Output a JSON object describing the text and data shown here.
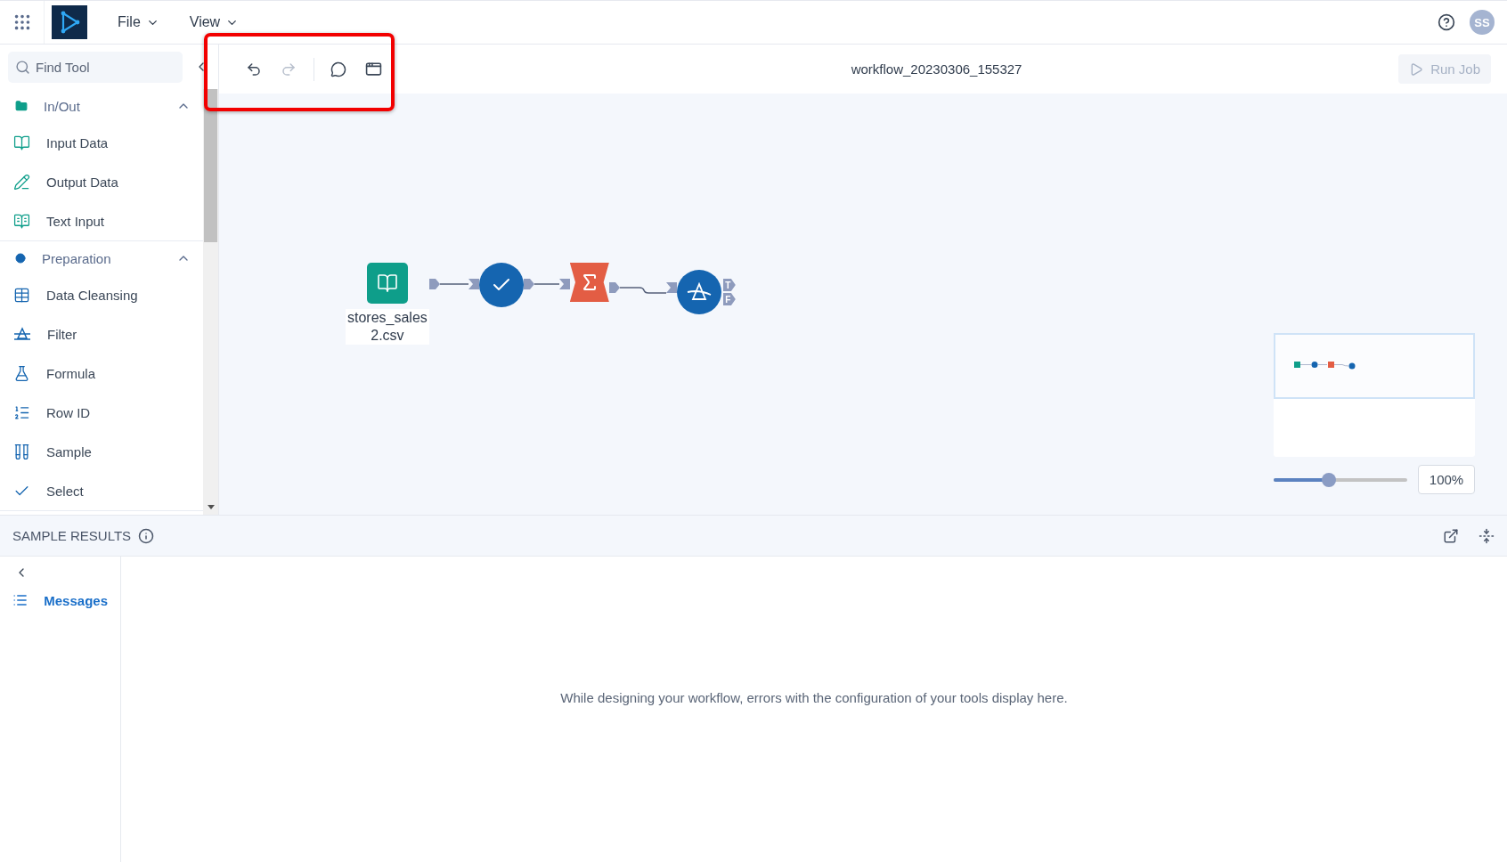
{
  "topbar": {
    "menus": [
      {
        "label": "File"
      },
      {
        "label": "View"
      }
    ],
    "avatar": "SS"
  },
  "sidebar": {
    "search": {
      "placeholder": "Find Tool"
    },
    "groups": [
      {
        "label": "In/Out",
        "kind": "folder",
        "color": "#0e9e8a",
        "expanded": true,
        "items": [
          {
            "label": "Input Data",
            "kind": "input"
          },
          {
            "label": "Output Data",
            "kind": "output"
          },
          {
            "label": "Text Input",
            "kind": "text-input"
          }
        ]
      },
      {
        "label": "Preparation",
        "kind": "dot",
        "color": "#1565b0",
        "expanded": true,
        "items": [
          {
            "label": "Data Cleansing",
            "kind": "cleansing"
          },
          {
            "label": "Filter",
            "kind": "filter"
          },
          {
            "label": "Formula",
            "kind": "formula"
          },
          {
            "label": "Row ID",
            "kind": "row-id"
          },
          {
            "label": "Sample",
            "kind": "sample"
          },
          {
            "label": "Select",
            "kind": "select"
          }
        ]
      }
    ]
  },
  "toolbar": {
    "undo": {
      "disabled": false
    },
    "redo": {
      "disabled": true
    },
    "title": "workflow_20230306_155327",
    "run_button": {
      "label": "Run Job",
      "disabled": true
    }
  },
  "canvas": {
    "nodes": [
      {
        "kind": "input",
        "color": "#0e9e8a",
        "label_lines": [
          "stores_sales",
          "2.csv"
        ]
      },
      {
        "kind": "select",
        "color": "#1565b0"
      },
      {
        "kind": "summarize",
        "color": "#e35d44"
      },
      {
        "kind": "filter",
        "color": "#1565b0",
        "outputs": [
          "T",
          "F"
        ]
      }
    ],
    "zoom": {
      "level": 0.41,
      "value": "100%"
    }
  },
  "results": {
    "title": "SAMPLE RESULTS",
    "tabs": [
      {
        "label": "Messages",
        "selected": true
      }
    ],
    "empty_message": "While designing your workflow, errors with the configuration of your tools display here."
  }
}
